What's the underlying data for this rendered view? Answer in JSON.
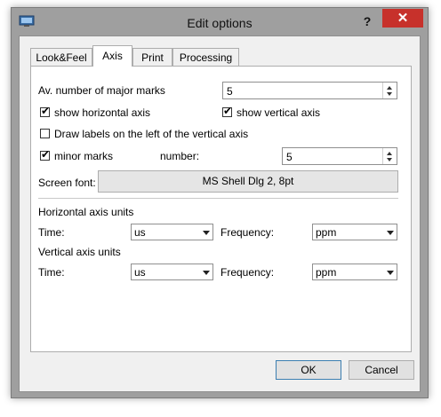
{
  "window": {
    "title": "Edit options",
    "help_label": "?",
    "close_label": "✕"
  },
  "tabs": [
    {
      "label": "Look&Feel",
      "active": false
    },
    {
      "label": "Axis",
      "active": true
    },
    {
      "label": "Print",
      "active": false
    },
    {
      "label": "Processing",
      "active": false
    }
  ],
  "axis": {
    "major_marks": {
      "label": "Av. number of major marks",
      "value": "5"
    },
    "show_horizontal": {
      "label": "show horizontal axis",
      "checked": true
    },
    "show_vertical": {
      "label": "show vertical axis",
      "checked": true
    },
    "labels_left": {
      "label": "Draw labels on the left of the vertical axis",
      "checked": false
    },
    "minor_marks": {
      "label": "minor marks",
      "checked": true
    },
    "number": {
      "label": "number:",
      "value": "5"
    },
    "screen_font": {
      "label": "Screen font:",
      "value": "MS Shell Dlg 2, 8pt"
    },
    "horizontal_units": {
      "heading": "Horizontal axis units",
      "time_label": "Time:",
      "time_value": "us",
      "frequency_label": "Frequency:",
      "frequency_value": "ppm"
    },
    "vertical_units": {
      "heading": "Vertical axis units",
      "time_label": "Time:",
      "time_value": "us",
      "frequency_label": "Frequency:",
      "frequency_value": "ppm"
    }
  },
  "buttons": {
    "ok": "OK",
    "cancel": "Cancel"
  },
  "colors": {
    "close": "#c7312b",
    "frame": "#9f9f9f",
    "dialog_bg": "#f0f0f0"
  }
}
